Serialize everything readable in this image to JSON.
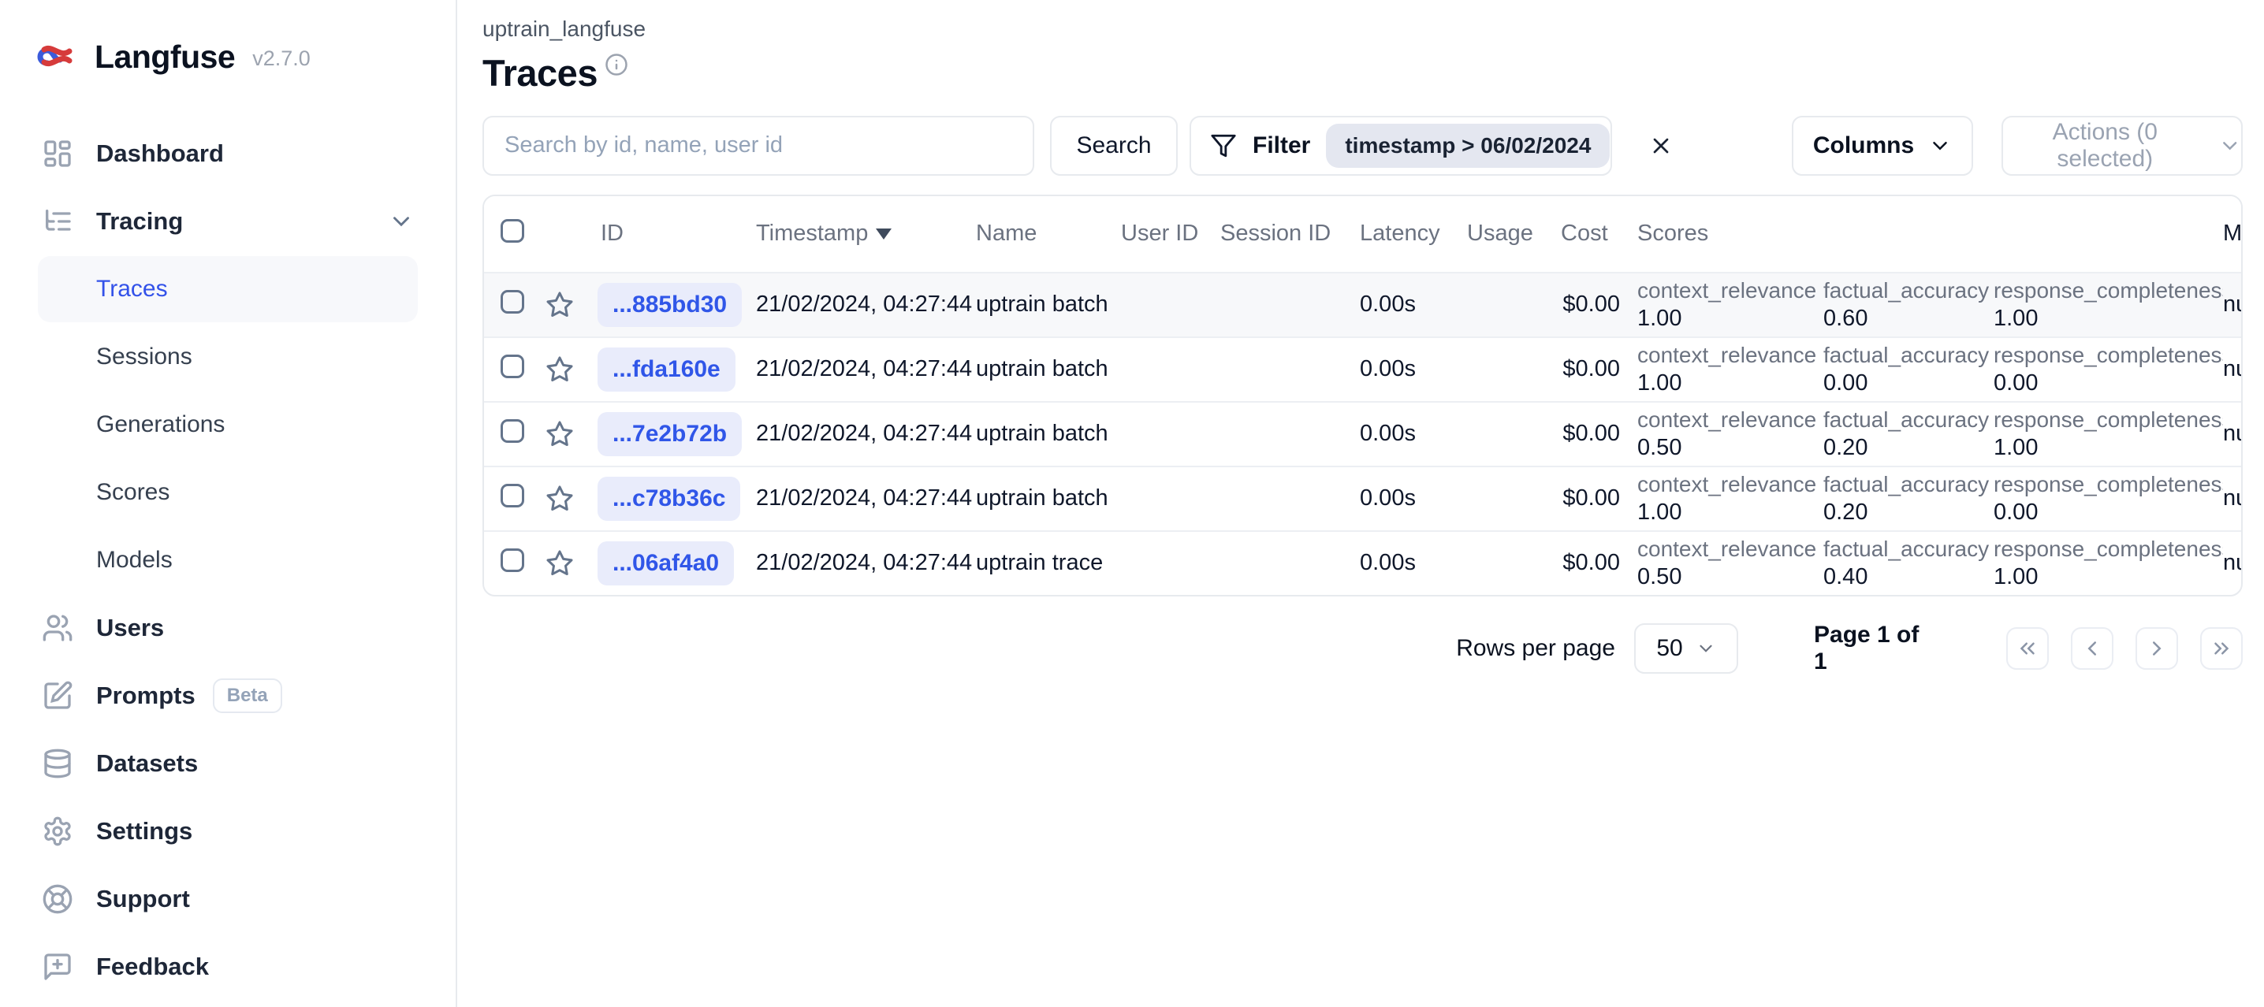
{
  "app": {
    "name": "Langfuse",
    "version": "v2.7.0"
  },
  "sidebar": {
    "dashboard": {
      "label": "Dashboard"
    },
    "tracing": {
      "label": "Tracing",
      "children": {
        "traces": "Traces",
        "sessions": "Sessions",
        "generations": "Generations",
        "scores": "Scores",
        "models": "Models"
      },
      "active_child": "Traces"
    },
    "users": {
      "label": "Users"
    },
    "prompts": {
      "label": "Prompts",
      "badge": "Beta"
    },
    "datasets": {
      "label": "Datasets"
    },
    "settings": {
      "label": "Settings"
    },
    "support": {
      "label": "Support"
    },
    "feedback": {
      "label": "Feedback"
    }
  },
  "header": {
    "breadcrumb": "uptrain_langfuse",
    "title": "Traces"
  },
  "toolbar": {
    "search_placeholder": "Search by id, name, user id",
    "search_button": "Search",
    "filter_label": "Filter",
    "filter_chip": "timestamp > 06/02/2024",
    "columns_label": "Columns",
    "actions_label": "Actions (0 selected)"
  },
  "table": {
    "headers": {
      "id": "ID",
      "timestamp": "Timestamp",
      "name": "Name",
      "user_id": "User ID",
      "session_id": "Session ID",
      "latency": "Latency",
      "usage": "Usage",
      "cost": "Cost",
      "scores": "Scores",
      "metadata": "Metadata"
    },
    "sort": {
      "column": "Timestamp",
      "direction": "desc"
    },
    "rows": [
      {
        "id": "...885bd30",
        "timestamp": "21/02/2024, 04:27:44",
        "name": "uptrain batch",
        "user_id": "",
        "session_id": "",
        "latency": "0.00s",
        "usage": "",
        "cost": "$0.00",
        "scores": [
          {
            "label": "context_relevance",
            "value": "1.00"
          },
          {
            "label": "factual_accuracy",
            "value": "0.60"
          },
          {
            "label": "response_completeness",
            "value": "1.00"
          }
        ],
        "metadata": "null"
      },
      {
        "id": "...fda160e",
        "timestamp": "21/02/2024, 04:27:44",
        "name": "uptrain batch",
        "user_id": "",
        "session_id": "",
        "latency": "0.00s",
        "usage": "",
        "cost": "$0.00",
        "scores": [
          {
            "label": "context_relevance",
            "value": "1.00"
          },
          {
            "label": "factual_accuracy",
            "value": "0.00"
          },
          {
            "label": "response_completeness",
            "value": "0.00"
          }
        ],
        "metadata": "null"
      },
      {
        "id": "...7e2b72b",
        "timestamp": "21/02/2024, 04:27:44",
        "name": "uptrain batch",
        "user_id": "",
        "session_id": "",
        "latency": "0.00s",
        "usage": "",
        "cost": "$0.00",
        "scores": [
          {
            "label": "context_relevance",
            "value": "0.50"
          },
          {
            "label": "factual_accuracy",
            "value": "0.20"
          },
          {
            "label": "response_completeness",
            "value": "1.00"
          }
        ],
        "metadata": "null"
      },
      {
        "id": "...c78b36c",
        "timestamp": "21/02/2024, 04:27:44",
        "name": "uptrain batch",
        "user_id": "",
        "session_id": "",
        "latency": "0.00s",
        "usage": "",
        "cost": "$0.00",
        "scores": [
          {
            "label": "context_relevance",
            "value": "1.00"
          },
          {
            "label": "factual_accuracy",
            "value": "0.20"
          },
          {
            "label": "response_completeness",
            "value": "0.00"
          }
        ],
        "metadata": "null"
      },
      {
        "id": "...06af4a0",
        "timestamp": "21/02/2024, 04:27:44",
        "name": "uptrain trace",
        "user_id": "",
        "session_id": "",
        "latency": "0.00s",
        "usage": "",
        "cost": "$0.00",
        "scores": [
          {
            "label": "context_relevance",
            "value": "0.50"
          },
          {
            "label": "factual_accuracy",
            "value": "0.40"
          },
          {
            "label": "response_completeness",
            "value": "1.00"
          }
        ],
        "metadata": "null"
      }
    ]
  },
  "pagination": {
    "rows_per_page_label": "Rows per page",
    "rows_per_page_value": "50",
    "page_status": "Page 1 of 1"
  },
  "colors": {
    "accent_blue": "#3352e9",
    "id_chip_bg": "#e9ecfb",
    "filter_chip_bg": "#e4e7f0",
    "row_highlight": "#f7f8fa",
    "border": "#e7eaee",
    "muted_text": "#6b7280"
  }
}
